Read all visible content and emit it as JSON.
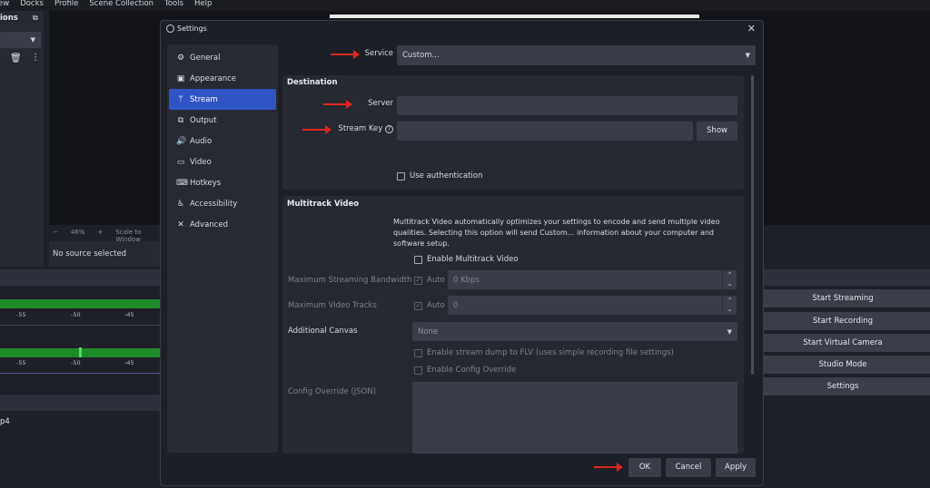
{
  "menubar": [
    "ew",
    "Docks",
    "Profile",
    "Scene Collection",
    "Tools",
    "Help"
  ],
  "scenes": {
    "title": "ions"
  },
  "preview": {
    "zoom_minus": "−",
    "zoom": "46%",
    "zoom_plus": "+",
    "scale": "Scale to Window"
  },
  "source": {
    "text": "No source selected"
  },
  "mixer": {
    "ticks": [
      "-55",
      "-50",
      "-45"
    ],
    "partial": "p4"
  },
  "controls": [
    "Start Streaming",
    "Start Recording",
    "Start Virtual Camera",
    "Studio Mode",
    "Settings"
  ],
  "dialog": {
    "title": "Settings",
    "nav": [
      {
        "label": "General",
        "icon": "gear-icon",
        "glyph": "⚙"
      },
      {
        "label": "Appearance",
        "icon": "appearance-icon",
        "glyph": "▣"
      },
      {
        "label": "Stream",
        "icon": "antenna-icon",
        "glyph": "ᛘ",
        "active": true
      },
      {
        "label": "Output",
        "icon": "output-icon",
        "glyph": "⧉"
      },
      {
        "label": "Audio",
        "icon": "speaker-icon",
        "glyph": "🔊"
      },
      {
        "label": "Video",
        "icon": "monitor-icon",
        "glyph": "▭"
      },
      {
        "label": "Hotkeys",
        "icon": "keyboard-icon",
        "glyph": "⌨"
      },
      {
        "label": "Accessibility",
        "icon": "accessibility-icon",
        "glyph": "♿"
      },
      {
        "label": "Advanced",
        "icon": "tools-icon",
        "glyph": "✕"
      }
    ],
    "service": {
      "label": "Service",
      "value": "Custom..."
    },
    "destination": {
      "title": "Destination",
      "server_label": "Server",
      "server_value": "",
      "key_label": "Stream Key",
      "key_value": "",
      "show": "Show",
      "auth": "Use authentication"
    },
    "multitrack": {
      "title": "Multitrack Video",
      "desc": "Multitrack Video automatically optimizes your settings to encode and send multiple video qualities. Selecting this option will send Custom... information about your computer and software setup.",
      "enable": "Enable Multitrack Video",
      "bandwidth_label": "Maximum Streaming Bandwidth",
      "bandwidth_auto": "Auto",
      "bandwidth_value": "0 Kbps",
      "tracks_label": "Maximum Video Tracks",
      "tracks_auto": "Auto",
      "tracks_value": "0",
      "canvas_label": "Additional Canvas",
      "canvas_value": "None",
      "dump": "Enable stream dump to FLV (uses simple recording file settings)",
      "override": "Enable Config Override",
      "json_label": "Config Override (JSON)"
    },
    "buttons": {
      "ok": "OK",
      "cancel": "Cancel",
      "apply": "Apply"
    }
  },
  "colors": {
    "accent": "#2f55c4",
    "annotation_arrow": "#e0261f",
    "meter": "#1f8a2a"
  }
}
